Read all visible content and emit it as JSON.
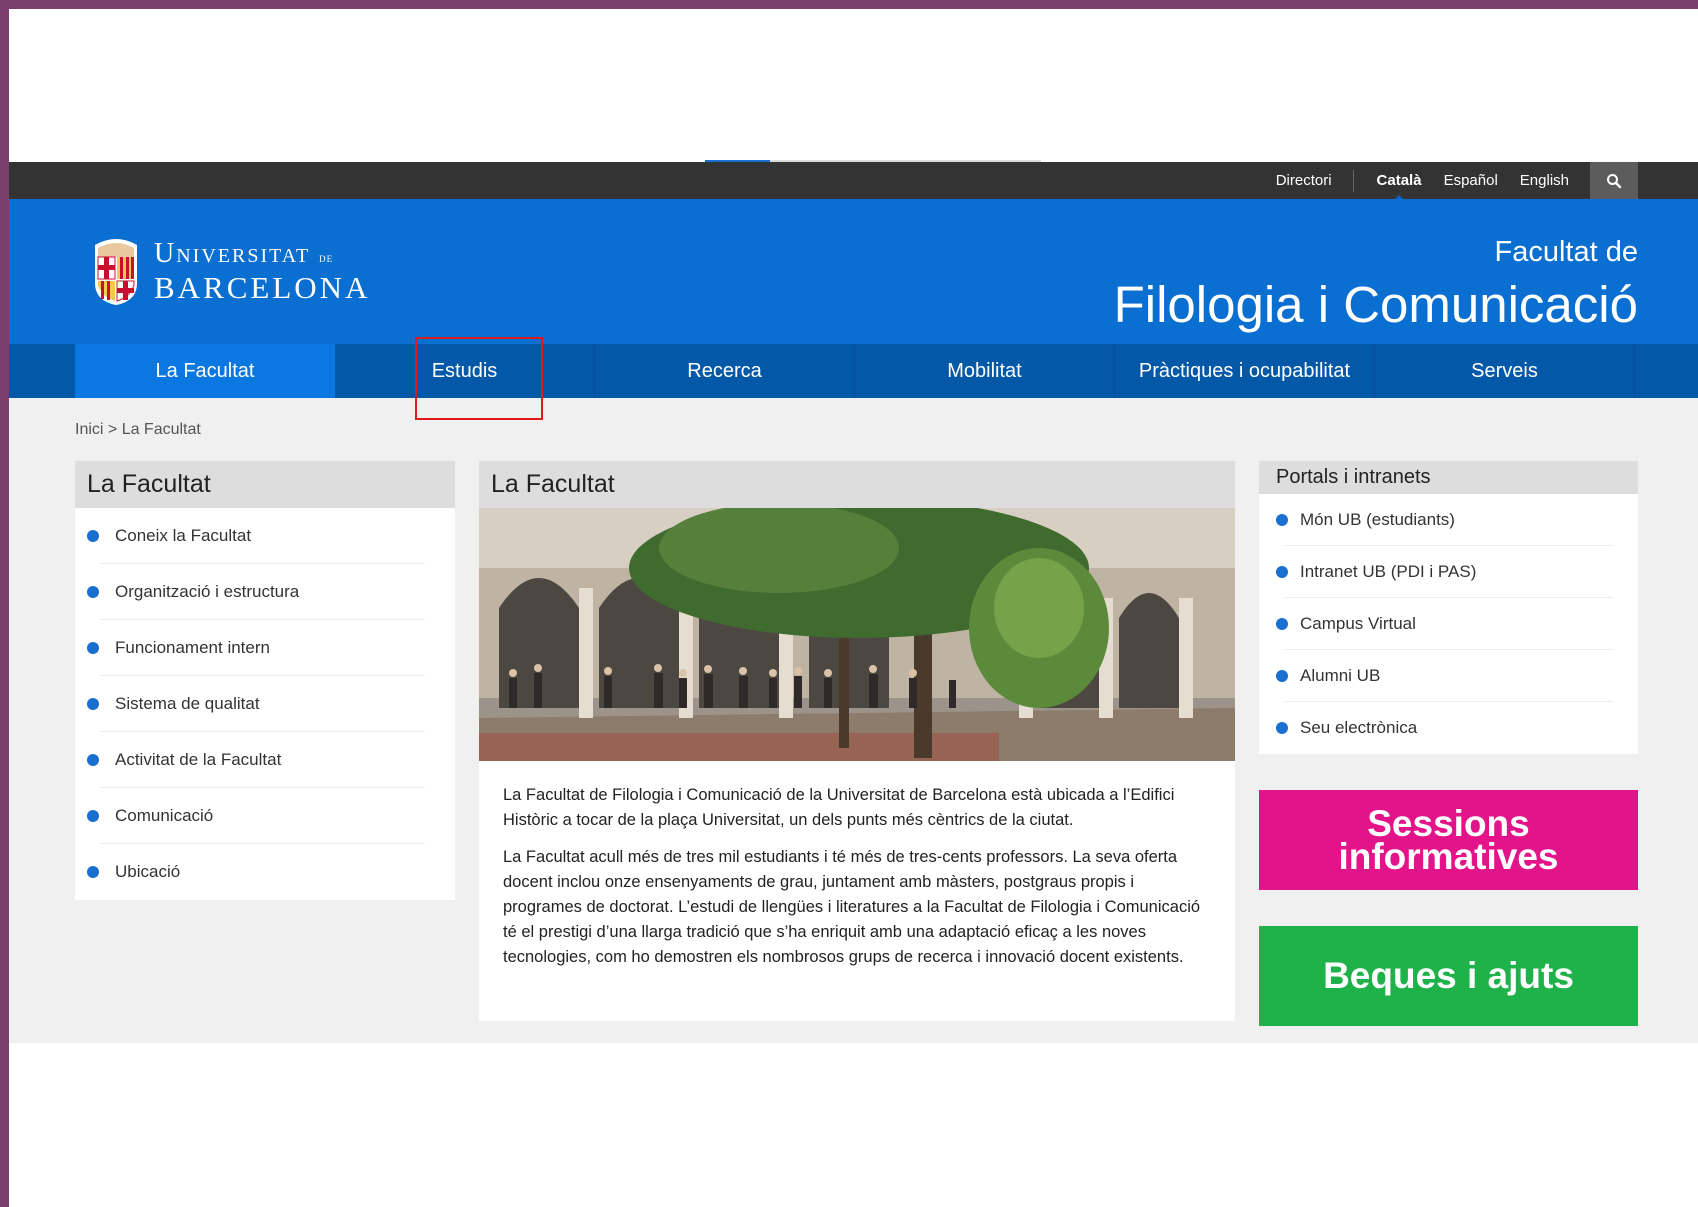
{
  "topbar": {
    "links": [
      "Directori",
      "Català",
      "Español",
      "English"
    ],
    "active": "Català",
    "search_icon": "search-icon"
  },
  "header": {
    "logo_line1": "Universitat",
    "logo_line1_small": "de",
    "logo_line2": "Barcelona",
    "faculty_sub": "Facultat de",
    "faculty_main": "Filologia i Comunicació"
  },
  "nav": {
    "items": [
      "La Facultat",
      "Estudis",
      "Recerca",
      "Mobilitat",
      "Pràctiques i ocupabilitat",
      "Serveis"
    ]
  },
  "breadcrumb": "Inici > La Facultat",
  "left": {
    "title": "La Facultat",
    "items": [
      "Coneix la Facultat",
      "Organització i estructura",
      "Funcionament intern",
      "Sistema de qualitat",
      "Activitat de la Facultat",
      "Comunicació",
      "Ubicació"
    ]
  },
  "center": {
    "title": "La Facultat",
    "p1": "La Facultat de Filologia i Comunicació de la Universitat de Barcelona està ubicada a l’Edifici Històric a tocar de la plaça Universitat, un dels punts més cèntrics de la ciutat.",
    "p2": "La Facultat acull més de tres mil estudiants i té més de tres-cents professors. La seva oferta docent inclou onze ensenyaments de grau, juntament amb màsters, postgraus propis i programes de doctorat. L’estudi de llengües i literatures a la Facultat de Filologia i Comunicació té el prestigi d’una llarga tradició que s’ha enriquit amb una adaptació eficaç a les noves tecnologies, com ho demostren els nombrosos grups de recerca i innovació docent existents."
  },
  "right": {
    "title": "Portals i intranets",
    "items": [
      "Món UB (estudiants)",
      "Intranet UB (PDI i PAS)",
      "Campus Virtual",
      "Alumni UB",
      "Seu electrònica"
    ],
    "promo1_line1": "Sessions",
    "promo1_line2": "informatives",
    "promo2": "Beques i ajuts"
  },
  "colors": {
    "brand_blue": "#0a6fd1",
    "nav_blue": "#0458a8",
    "pink": "#e3138a",
    "green": "#1fb24a",
    "highlight": "#e01a1a"
  }
}
